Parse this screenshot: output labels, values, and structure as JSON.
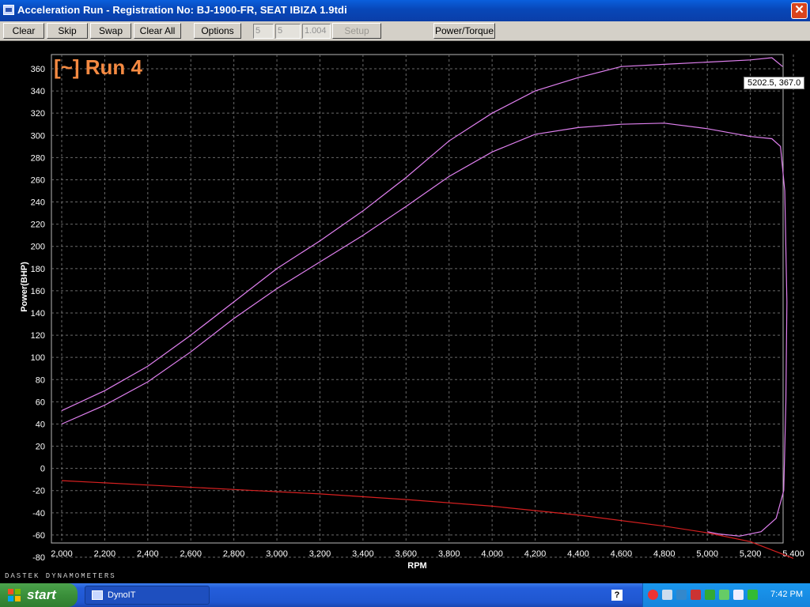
{
  "window": {
    "title": "Acceleration Run - Registration No: BJ-1900-FR,  SEAT IBIZA 1.9tdi",
    "close_label": "✕"
  },
  "toolbar": {
    "clear": "Clear",
    "skip": "Skip",
    "swap": "Swap",
    "clear_all": "Clear All",
    "options": "Options",
    "field1": "5",
    "field2": "5",
    "field3": "1.004",
    "setup": "Setup",
    "power_torque": "Power/Torque"
  },
  "chart": {
    "heading": "[~] Run 4",
    "cursor_readout": "5202.5,  367.0",
    "brand": "DASTEK DYNAMOMETERS"
  },
  "chart_data": {
    "type": "line",
    "xlabel": "RPM",
    "ylabel": "Power(BHP)",
    "xlim": [
      2000,
      5400
    ],
    "ylim": [
      -80,
      360
    ],
    "x_ticks": [
      "2,000",
      "2,200",
      "2,400",
      "2,600",
      "2,800",
      "3,000",
      "3,200",
      "3,400",
      "3,600",
      "3,800",
      "4,000",
      "4,200",
      "4,400",
      "4,600",
      "4,800",
      "5,000",
      "5,200",
      "5,400"
    ],
    "y_ticks": [
      "360",
      "340",
      "320",
      "300",
      "280",
      "260",
      "240",
      "220",
      "200",
      "180",
      "160",
      "140",
      "120",
      "100",
      "80",
      "60",
      "40",
      "20",
      "0",
      "-20",
      "-40",
      "-60",
      "-80"
    ],
    "grid": true,
    "series": [
      {
        "color": "#e080f0",
        "points": [
          [
            2000,
            52
          ],
          [
            2200,
            70
          ],
          [
            2400,
            92
          ],
          [
            2600,
            120
          ],
          [
            2800,
            150
          ],
          [
            3000,
            180
          ],
          [
            3200,
            205
          ],
          [
            3400,
            232
          ],
          [
            3600,
            262
          ],
          [
            3800,
            295
          ],
          [
            4000,
            320
          ],
          [
            4200,
            340
          ],
          [
            4400,
            352
          ],
          [
            4600,
            362
          ],
          [
            4800,
            364
          ],
          [
            5000,
            366
          ],
          [
            5200,
            368
          ],
          [
            5300,
            370
          ],
          [
            5350,
            362
          ]
        ]
      },
      {
        "color": "#e080f0",
        "points": [
          [
            2000,
            40
          ],
          [
            2200,
            57
          ],
          [
            2400,
            78
          ],
          [
            2600,
            105
          ],
          [
            2800,
            135
          ],
          [
            3000,
            162
          ],
          [
            3200,
            186
          ],
          [
            3400,
            210
          ],
          [
            3600,
            236
          ],
          [
            3800,
            263
          ],
          [
            4000,
            285
          ],
          [
            4200,
            301
          ],
          [
            4400,
            307
          ],
          [
            4600,
            310
          ],
          [
            4800,
            311
          ],
          [
            5000,
            306
          ],
          [
            5200,
            299
          ],
          [
            5300,
            297
          ],
          [
            5340,
            290
          ],
          [
            5360,
            250
          ],
          [
            5370,
            150
          ],
          [
            5365,
            60
          ],
          [
            5355,
            -20
          ],
          [
            5320,
            -45
          ],
          [
            5250,
            -57
          ],
          [
            5150,
            -61
          ],
          [
            5050,
            -59
          ],
          [
            5000,
            -57
          ]
        ]
      },
      {
        "color": "#d82020",
        "points": [
          [
            2000,
            -11
          ],
          [
            2400,
            -15
          ],
          [
            2800,
            -19
          ],
          [
            3200,
            -23
          ],
          [
            3600,
            -28
          ],
          [
            4000,
            -34
          ],
          [
            4400,
            -42
          ],
          [
            4800,
            -52
          ],
          [
            5000,
            -58
          ],
          [
            5200,
            -66
          ],
          [
            5400,
            -81
          ]
        ]
      }
    ]
  },
  "taskbar": {
    "start": "start",
    "task": "DynoIT",
    "help": "?",
    "clock": "7:42 PM"
  }
}
